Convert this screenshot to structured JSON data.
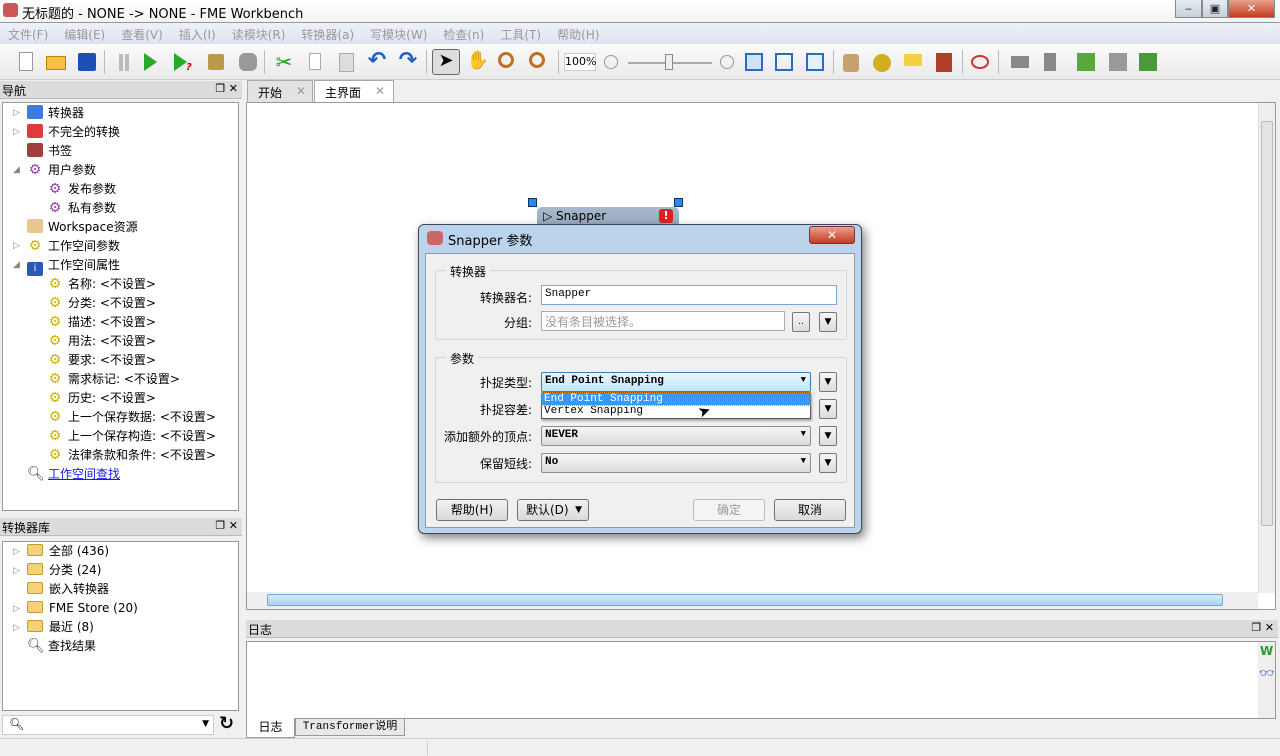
{
  "window": {
    "title": "无标题的 - NONE -> NONE - FME Workbench",
    "min": "‒",
    "max": "▣",
    "close": "✕"
  },
  "menu": [
    "文件(F)",
    "编辑(E)",
    "查看(V)",
    "插入(I)",
    "读模块(R)",
    "转换器(a)",
    "写模块(W)",
    "检查(n)",
    "工具(T)",
    "帮助(H)"
  ],
  "toolbar": {
    "zoom": "100%"
  },
  "nav": {
    "title": "导航",
    "items": [
      {
        "label": "转换器"
      },
      {
        "label": "不完全的转换"
      },
      {
        "label": "书签"
      },
      {
        "label": "用户参数"
      },
      {
        "label": "发布参数"
      },
      {
        "label": "私有参数"
      },
      {
        "label": "Workspace资源"
      },
      {
        "label": "工作空间参数"
      },
      {
        "label": "工作空间属性"
      },
      {
        "label": "名称: <不设置>"
      },
      {
        "label": "分类: <不设置>"
      },
      {
        "label": "描述: <不设置>"
      },
      {
        "label": "用法: <不设置>"
      },
      {
        "label": "要求: <不设置>"
      },
      {
        "label": "需求标记: <不设置>"
      },
      {
        "label": "历史: <不设置>"
      },
      {
        "label": "上一个保存数据: <不设置>"
      },
      {
        "label": "上一个保存构造: <不设置>"
      },
      {
        "label": "法律条款和条件: <不设置>"
      }
    ],
    "search_link": "工作空间查找"
  },
  "library": {
    "title": "转换器库",
    "items": [
      {
        "label": "全部 (436)"
      },
      {
        "label": "分类 (24)"
      },
      {
        "label": "嵌入转换器"
      },
      {
        "label": "FME Store (20)"
      },
      {
        "label": "最近 (8)"
      },
      {
        "label": "查找结果"
      }
    ]
  },
  "tabs": [
    {
      "label": "开始"
    },
    {
      "label": "主界面"
    }
  ],
  "canvas": {
    "node": "Snapper"
  },
  "log": {
    "title": "日志",
    "tabs": [
      "日志",
      "Transformer说明"
    ]
  },
  "dialog": {
    "title": "Snapper 参数",
    "group1": "转换器",
    "name_label": "转换器名:",
    "name_value": "Snapper",
    "group_label": "分组:",
    "group_placeholder": "没有条目被选择。",
    "browse": "..",
    "group2": "参数",
    "snap_type_label": "扑捉类型:",
    "snap_type_value": "End Point Snapping",
    "snap_options": [
      "End Point Snapping",
      "Vertex Snapping"
    ],
    "tolerance_label": "扑捉容差:",
    "extra_label": "添加额外的顶点:",
    "extra_value": "NEVER",
    "keep_label": "保留短线:",
    "keep_value": "No",
    "help": "帮助(H)",
    "defaults": "默认(D)",
    "ok": "确定",
    "cancel": "取消"
  }
}
